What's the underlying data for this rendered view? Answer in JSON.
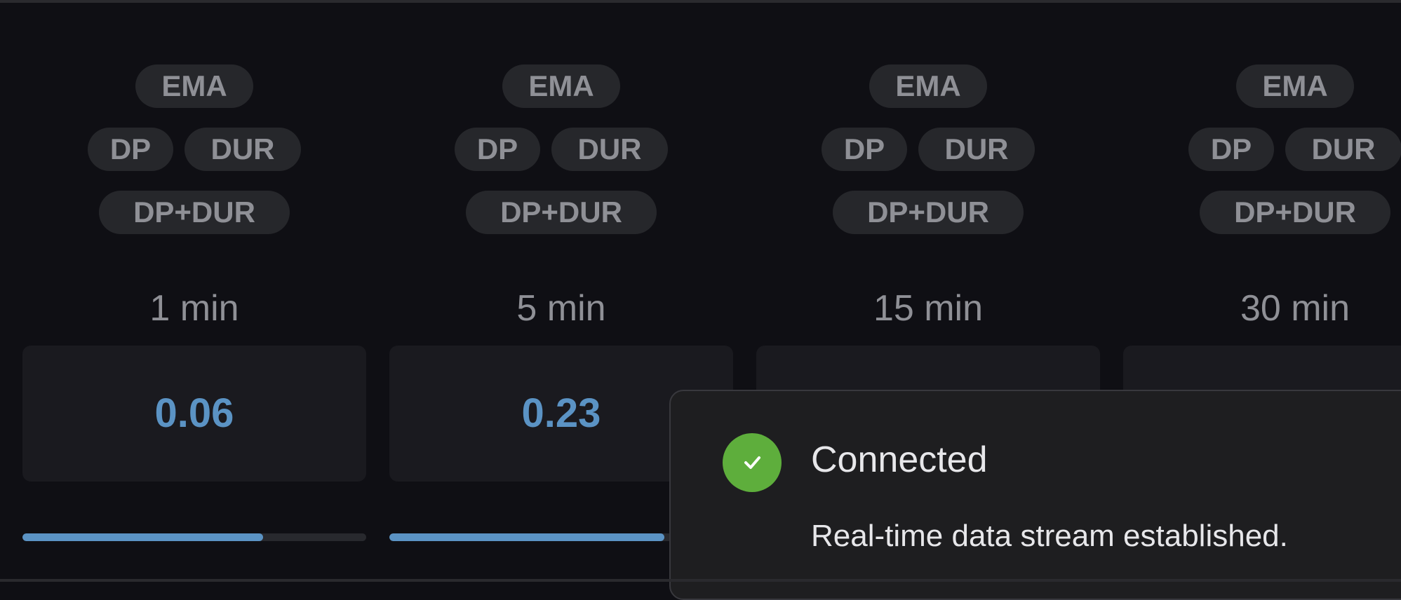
{
  "filters": {
    "ema_label": "EMA",
    "dp_label": "DP",
    "dur_label": "DUR",
    "dp_dur_label": "DP+DUR"
  },
  "timeframes": [
    {
      "label": "1 min",
      "value": "0.06",
      "progress": 0.7
    },
    {
      "label": "5 min",
      "value": "0.23",
      "progress": 0.8
    },
    {
      "label": "15 min",
      "value": "",
      "progress": null
    },
    {
      "label": "30 min",
      "value": "",
      "progress": null
    }
  ],
  "toast": {
    "title": "Connected",
    "message": "Real-time data stream established.",
    "icon": "check-circle-icon",
    "icon_color": "#5eae3c"
  },
  "colors": {
    "background": "#0f0f14",
    "card": "#1a1a1f",
    "pill": "#26272b",
    "accent": "#5b93c4",
    "muted_text": "#8f9096"
  }
}
